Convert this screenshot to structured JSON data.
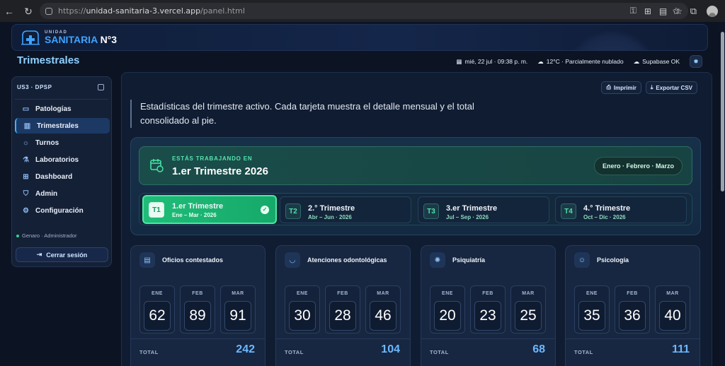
{
  "browser": {
    "url_prefix": "https://",
    "url_host": "unidad-sanitaria-3.vercel.app",
    "url_path": "/panel.html"
  },
  "banner": {
    "small": "UNIDAD",
    "big": "SANITARIA",
    "number": "N°3"
  },
  "header": {
    "title": "Trimestrales",
    "datetime": "mié, 22 jul · 09:38 p. m.",
    "weather": "12°C · Parcialmente nublado",
    "db_status": "Supabase OK"
  },
  "sidebar": {
    "head": "US3 · DPSP",
    "items": [
      {
        "label": "Patologías",
        "icon": "monitor-icon"
      },
      {
        "label": "Trimestrales",
        "icon": "bar-chart-icon"
      },
      {
        "label": "Turnos",
        "icon": "sun-icon"
      },
      {
        "label": "Laboratorios",
        "icon": "flask-icon"
      },
      {
        "label": "Dashboard",
        "icon": "grid-icon"
      },
      {
        "label": "Admin",
        "icon": "shield-icon"
      },
      {
        "label": "Configuración",
        "icon": "gear-icon"
      }
    ],
    "active_index": 1,
    "user": "Genaro · Administrador",
    "logout": "Cerrar sesión"
  },
  "actions": {
    "print": "Imprimir",
    "export": "Exportar CSV"
  },
  "intro": "Estadísticas del trimestre activo. Cada tarjeta muestra el detalle mensual y el total consolidado al pie.",
  "active_quarter": {
    "label": "ESTÁS TRABAJANDO EN",
    "title": "1.er Trimestre 2026",
    "months": "Enero · Febrero · Marzo"
  },
  "quarters": [
    {
      "badge": "T1",
      "title": "1.er Trimestre",
      "range": "Ene – Mar · 2026",
      "active": true
    },
    {
      "badge": "T2",
      "title": "2.° Trimestre",
      "range": "Abr – Jun · 2026",
      "active": false
    },
    {
      "badge": "T3",
      "title": "3.er Trimestre",
      "range": "Jul – Sep · 2026",
      "active": false
    },
    {
      "badge": "T4",
      "title": "4.° Trimestre",
      "range": "Oct – Dic · 2026",
      "active": false
    }
  ],
  "stats": {
    "total_label": "TOTAL",
    "cards": [
      {
        "title": "Oficios contestados",
        "icon": "document-icon",
        "months": [
          {
            "m": "ENE",
            "v": "62"
          },
          {
            "m": "FEB",
            "v": "89"
          },
          {
            "m": "MAR",
            "v": "91"
          }
        ],
        "total": "242"
      },
      {
        "title": "Atenciones odontológicas",
        "icon": "tooth-icon",
        "months": [
          {
            "m": "ENE",
            "v": "30"
          },
          {
            "m": "FEB",
            "v": "28"
          },
          {
            "m": "MAR",
            "v": "46"
          }
        ],
        "total": "104"
      },
      {
        "title": "Psiquiatría",
        "icon": "brain-icon",
        "months": [
          {
            "m": "ENE",
            "v": "20"
          },
          {
            "m": "FEB",
            "v": "23"
          },
          {
            "m": "MAR",
            "v": "25"
          }
        ],
        "total": "68"
      },
      {
        "title": "Psicología",
        "icon": "smile-icon",
        "months": [
          {
            "m": "ENE",
            "v": "35"
          },
          {
            "m": "FEB",
            "v": "36"
          },
          {
            "m": "MAR",
            "v": "40"
          }
        ],
        "total": "111"
      }
    ]
  },
  "colors": {
    "accent": "#3fb4ff",
    "success": "#1fbd78",
    "background": "#0c1424"
  }
}
